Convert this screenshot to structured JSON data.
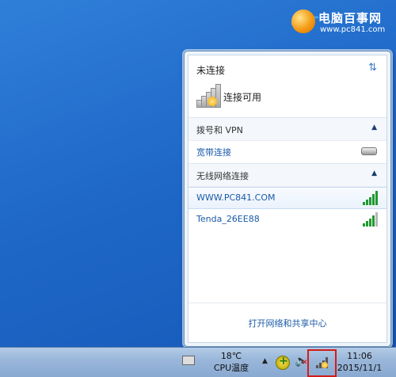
{
  "watermark": {
    "brand": "电脑百事网",
    "url": "www.pc841.com"
  },
  "flyout": {
    "status": "未连接",
    "connections_label": "连接可用",
    "sections": [
      {
        "title": "拨号和 VPN",
        "items": [
          {
            "label": "宽带连接",
            "icon": "modem-icon"
          }
        ]
      },
      {
        "title": "无线网络连接",
        "items": [
          {
            "label": "WWW.PC841.COM",
            "signal_bars": 5,
            "selected": true
          },
          {
            "label": "Tenda_26EE88",
            "signal_bars": 4,
            "selected": false
          }
        ]
      }
    ],
    "footer_link": "打开网络和共享中心"
  },
  "taskbar": {
    "temperature": "18℃",
    "temperature_label": "CPU温度",
    "time": "11:06",
    "date": "2015/11/1"
  }
}
